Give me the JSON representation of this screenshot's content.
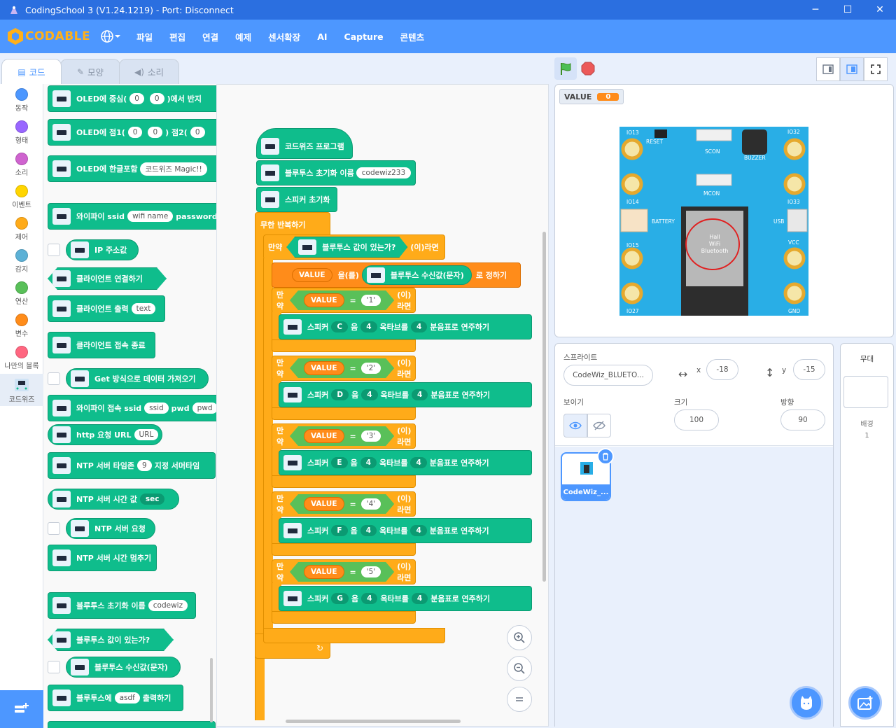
{
  "window": {
    "title": "CodingSchool 3 (V1.24.1219) - Port: Disconnect",
    "minimize": "─",
    "maximize": "☐",
    "close": "✕"
  },
  "menu": {
    "logo": "CODABLE",
    "items": [
      "파일",
      "편집",
      "연결",
      "예제",
      "센서확장",
      "AI",
      "Capture",
      "콘텐츠"
    ]
  },
  "tabs": [
    "코드",
    "모양",
    "소리"
  ],
  "categories": [
    {
      "label": "동작",
      "color": "#4c97ff"
    },
    {
      "label": "형태",
      "color": "#9966ff"
    },
    {
      "label": "소리",
      "color": "#cf63cf"
    },
    {
      "label": "이벤트",
      "color": "#ffd500"
    },
    {
      "label": "제어",
      "color": "#ffab19"
    },
    {
      "label": "감지",
      "color": "#5cb1d6"
    },
    {
      "label": "연산",
      "color": "#59c059"
    },
    {
      "label": "변수",
      "color": "#ff8c1a"
    },
    {
      "label": "나만의 블록",
      "color": "#ff6680"
    },
    {
      "label": "코드위즈",
      "color": "#0fbd8c"
    }
  ],
  "palette": {
    "oled_center": {
      "text": "OLED에 중심(",
      "a": "0",
      "b": "0",
      "tail": ")에서 반지"
    },
    "oled_point": {
      "text": "OLED에 점1(",
      "a": "0",
      "b": "0",
      "mid": ") 점2(",
      "c": "0"
    },
    "oled_korean": {
      "text": "OLED에 한글포함",
      "arg": "코드위즈 Magic!!"
    },
    "wifi_ssid": {
      "text": "와이파이 ssid",
      "arg": "wifi name",
      "mid": "password"
    },
    "ip_addr": "IP 주소값",
    "client_connect": "클라이언트 연결하기",
    "client_print": {
      "text": "클라이언트 출력",
      "arg": "text"
    },
    "client_end": "클라이언트 접속 종료",
    "get_data": "Get 방식으로 데이터 가져오기",
    "wifi_connect": {
      "text": "와이파이 접속 ssid",
      "a": "ssid",
      "mid": "pwd",
      "b": "pwd"
    },
    "http_url": {
      "text": "http 요청 URL",
      "arg": "URL"
    },
    "ntp_timezone": {
      "text": "NTP 서버 타임존",
      "arg": "9",
      "tail": "지정 서머타임"
    },
    "ntp_time": {
      "text": "NTP 서버 시간 값",
      "arg": "sec"
    },
    "ntp_request": "NTP 서버 요청",
    "ntp_stop": "NTP 서버 시간 멈추기",
    "bt_init": {
      "text": "블루투스 초기화 이름",
      "arg": "codewiz"
    },
    "bt_has": "블루투스 값이 있는가?",
    "bt_recv": "블루투스 수신값(문자)",
    "bt_print": {
      "text": "블루투스에",
      "arg": "asdf",
      "tail": "출력하기"
    }
  },
  "script": {
    "hat": "코드위즈 프로그램",
    "bt_init": {
      "text": "블루투스 초기화 이름",
      "arg": "codewiz233"
    },
    "speaker_init": "스피커 초기화",
    "forever": "무한 반복하기",
    "if_word": "만약",
    "then_word": "(이)라면",
    "bt_has": "블루투스 값이 있는가?",
    "set_var": {
      "var": "VALUE",
      "mid": "을(를)",
      "reporter": "블루투스 수신값(문자)",
      "tail": "로 정하기"
    },
    "equals": "=",
    "ifs": [
      {
        "val": "'1'",
        "note": "C"
      },
      {
        "val": "'2'",
        "note": "D"
      },
      {
        "val": "'3'",
        "note": "E"
      },
      {
        "val": "'4'",
        "note": "F"
      },
      {
        "val": "'5'",
        "note": "G"
      }
    ],
    "play": {
      "speaker": "스피커",
      "eum": "음",
      "octave": "4",
      "octave_label": "옥타브를",
      "beat": "4",
      "tail": "분음표로 연주하기"
    }
  },
  "stage": {
    "monitor_label": "VALUE",
    "monitor_value": "0",
    "board": {
      "io13": "IO13",
      "reset": "RESET",
      "scon": "SCON",
      "buzzer": "BUZZER",
      "io32": "IO32",
      "io14": "IO14",
      "mcon": "MCON",
      "io33": "IO33",
      "battery": "BATTERY",
      "usb": "USB",
      "io15": "IO15",
      "vcc": "VCC",
      "io27": "IO27",
      "gnd": "GND",
      "chip_text_1": "Hall",
      "chip_text_2": "WiFi",
      "chip_text_3": "Bluetooth"
    }
  },
  "sprite": {
    "label": "스프라이트",
    "name": "CodeWiz_BLUETO...",
    "x_label": "x",
    "x": "-18",
    "y_label": "y",
    "y": "-15",
    "show_label": "보이기",
    "size_label": "크기",
    "size": "100",
    "direction_label": "방향",
    "direction": "90",
    "thumb_name": "CodeWiz_..."
  },
  "stage_panel": {
    "title": "무대",
    "backdrop_label": "배경",
    "backdrop_count": "1"
  }
}
